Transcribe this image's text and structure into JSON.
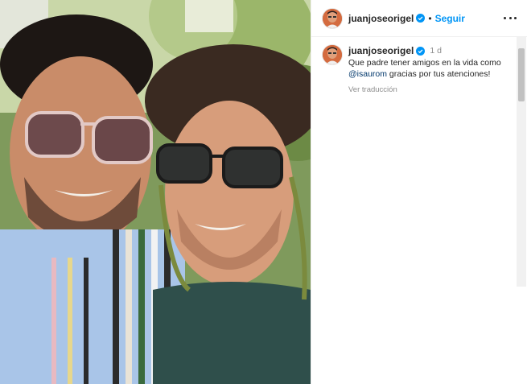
{
  "post": {
    "username": "juanjoseorigel",
    "follow_label": "Seguir",
    "separator": "•",
    "verified_color": "#0095f6"
  },
  "comment": {
    "username": "juanjoseorigel",
    "age": "1 d",
    "text_before_mention": "Que padre tener amigos en la vida como ",
    "mention": "@isaurom",
    "text_after_mention": " gracias por tus atenciones!",
    "translate_label": "Ver traducción"
  },
  "icons": {
    "header_more": "more-horizontal-icon",
    "verified": "verified-badge-icon"
  },
  "colors": {
    "link": "#0095f6",
    "mention": "#00376b",
    "muted": "#8e8e8e"
  }
}
